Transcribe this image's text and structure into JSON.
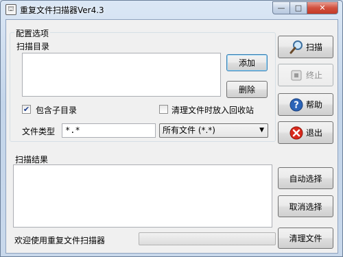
{
  "window": {
    "title": "重复文件扫描器Ver4.3",
    "controls": {
      "minimize": "—",
      "maximize": "□",
      "close": "✕"
    }
  },
  "config": {
    "group_label": "配置选项",
    "scan_dir_label": "扫描目录",
    "add_button": "添加",
    "delete_button": "删除",
    "include_subdirs": {
      "label": "包含子目录",
      "checked": true
    },
    "recycle_bin": {
      "label": "清理文件时放入回收站",
      "checked": false
    },
    "file_type_label": "文件类型",
    "file_type_value": "*.*",
    "file_type_select": "所有文件 (*.*)"
  },
  "side_buttons": {
    "scan": "扫描",
    "stop": "终止",
    "help": "帮助",
    "exit": "退出"
  },
  "results": {
    "label": "扫描结果",
    "auto_select": "自动选择",
    "cancel_select": "取消选择",
    "clean_files": "清理文件"
  },
  "status": {
    "text": "欢迎使用重复文件扫描器",
    "progress": 0
  }
}
